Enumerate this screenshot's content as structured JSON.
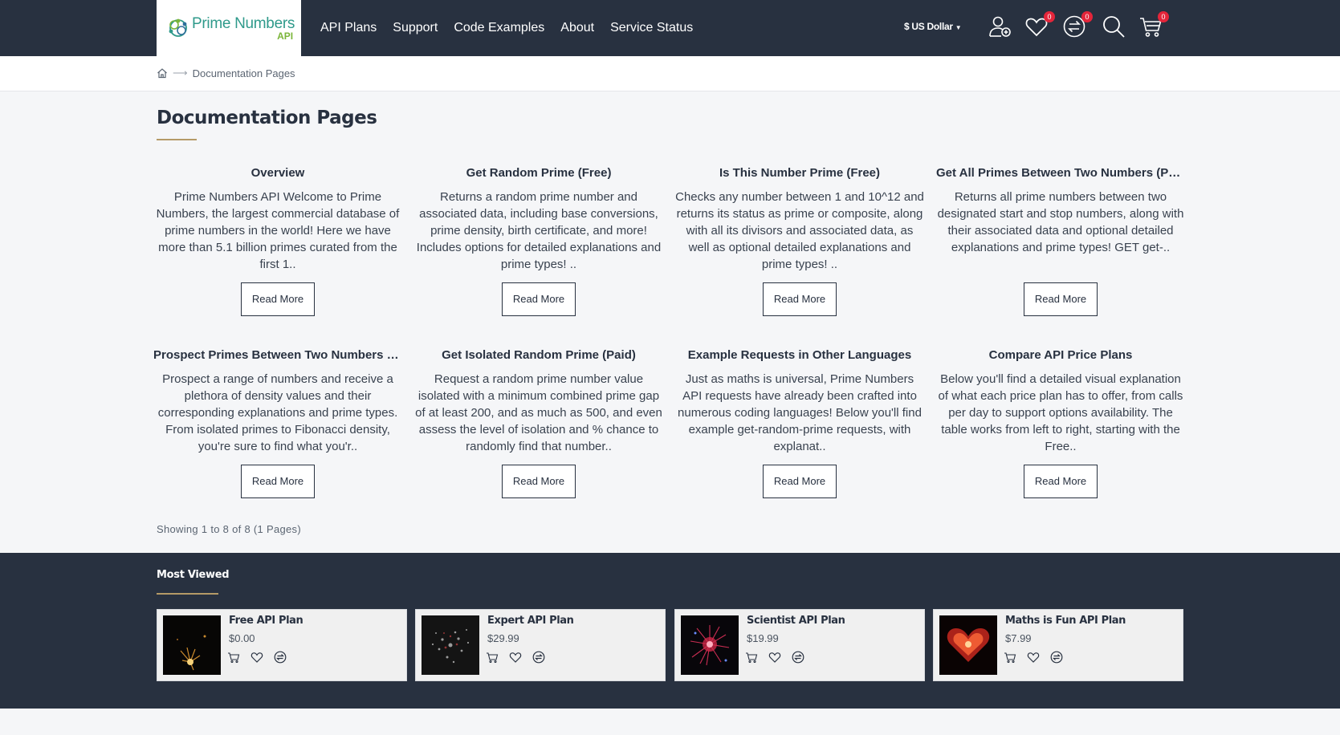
{
  "brand": {
    "name": "Prime Numbers",
    "sub": "API",
    "logo_icon": "molecule-logo-icon"
  },
  "nav": [
    {
      "label": "API Plans"
    },
    {
      "label": "Support"
    },
    {
      "label": "Code Examples"
    },
    {
      "label": "About"
    },
    {
      "label": "Service Status"
    }
  ],
  "header": {
    "currency": "$ US Dollar",
    "icons": [
      "user-add-icon",
      "heart-icon",
      "compare-icon",
      "search-icon",
      "cart-icon"
    ],
    "wishlist_count": "0",
    "compare_count": "0",
    "cart_count": "0"
  },
  "breadcrumb": {
    "current": "Documentation Pages"
  },
  "page_title": "Documentation Pages",
  "articles": [
    {
      "title": "Overview",
      "excerpt": "Prime Numbers API Welcome to Prime Numbers, the largest commercial database of prime numbers in the world! Here we have more than 5.1 billion primes curated from the first 1..",
      "button": "Read More"
    },
    {
      "title": "Get Random Prime (Free)",
      "excerpt": "Returns a random prime number and associated data, including base conversions, prime density, birth certificate, and more! Includes options for detailed explanations and prime types! ..",
      "button": "Read More"
    },
    {
      "title": "Is This Number Prime (Free)",
      "excerpt": "Checks any number between 1 and 10^12 and returns its status as prime or composite, along with all its divisors and associated data, as well as optional detailed explanations and prime types! ..",
      "button": "Read More"
    },
    {
      "title": "Get All Primes Between Two Numbers (Paid)",
      "excerpt": "Returns all prime numbers between two designated start and stop numbers, along with their associated data and optional detailed explanations and prime types! GET get-..",
      "button": "Read More"
    },
    {
      "title": "Prospect Primes Between Two Numbers (P...",
      "excerpt": "Prospect a range of numbers and receive a plethora of density values and their corresponding explanations and prime types. From isolated primes to Fibonacci density, you're sure to find what you'r..",
      "button": "Read More"
    },
    {
      "title": "Get Isolated Random Prime (Paid)",
      "excerpt": "Request a random prime number value isolated with a minimum combined prime gap of at least 200, and as much as 500, and even assess the level of isolation and % chance to randomly find that number..",
      "button": "Read More"
    },
    {
      "title": "Example Requests in Other Languages",
      "excerpt": "Just as maths is universal, Prime Numbers API requests have already been crafted into numerous coding languages! Below you'll find example get-random-prime requests, with explanat..",
      "button": "Read More"
    },
    {
      "title": "Compare API Price Plans",
      "excerpt": "Below you'll find a detailed visual explanation of what each price plan has to offer, from calls per day to support options availability. The table works from left to right, starting with the Free..",
      "button": "Read More"
    }
  ],
  "pagination_text": "Showing 1 to 8 of 8 (1 Pages)",
  "most_viewed": {
    "title": "Most Viewed",
    "products": [
      {
        "name": "Free API Plan",
        "price": "$0.00"
      },
      {
        "name": "Expert API Plan",
        "price": "$29.99"
      },
      {
        "name": "Scientist API Plan",
        "price": "$19.99"
      },
      {
        "name": "Maths is Fun API Plan",
        "price": "$7.99"
      }
    ]
  },
  "colors": {
    "header_bg": "#283140",
    "accent": "#b59a67",
    "badge": "#e4253a",
    "page_bg": "#f5f6f8"
  }
}
